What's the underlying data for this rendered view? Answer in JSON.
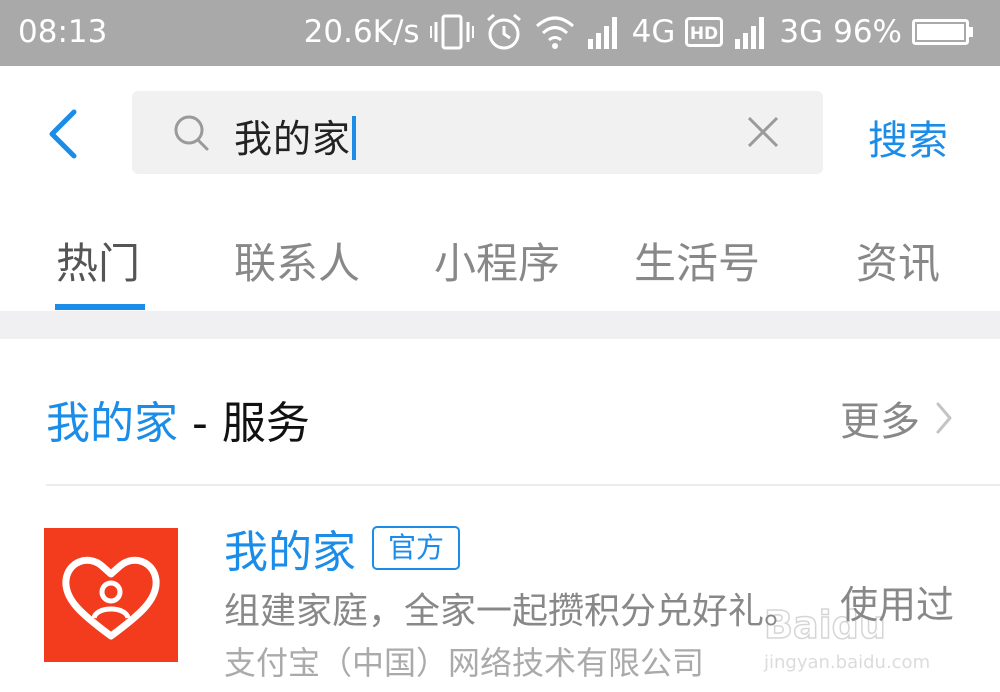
{
  "status_bar": {
    "time": "08:13",
    "speed": "20.6K/s",
    "network_1": "4G",
    "network_2": "3G",
    "battery": "96%"
  },
  "search": {
    "query": "我的家",
    "submit_label": "搜索"
  },
  "tabs": [
    {
      "label": "热门"
    },
    {
      "label": "联系人"
    },
    {
      "label": "小程序"
    },
    {
      "label": "生活号"
    },
    {
      "label": "资讯"
    }
  ],
  "section": {
    "title_highlight": "我的家",
    "title_rest": " - 服务",
    "more_label": "更多"
  },
  "result": {
    "name": "我的家",
    "badge": "官方",
    "description": "组建家庭，全家一起攒积分兑好礼。",
    "company": "支付宝（中国）网络技术有限公司",
    "status": "使用过"
  },
  "watermark": {
    "url": "jingyan.baidu.com"
  },
  "colors": {
    "accent": "#1b8ce8",
    "logo_bg": "#f23c1d",
    "status_bar_bg": "#a9a9a9"
  }
}
